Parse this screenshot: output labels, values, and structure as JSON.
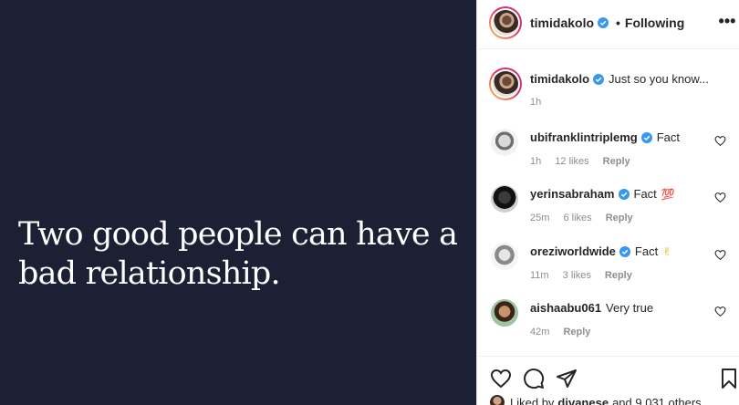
{
  "post": {
    "quote": "Two good people can have a bad relationship."
  },
  "header": {
    "username": "timidakolo",
    "separator": "•",
    "follow_state": "Following",
    "more_label": "•••"
  },
  "caption": {
    "username": "timidakolo",
    "text": "Just so you know...",
    "time": "1h"
  },
  "comments": [
    {
      "username": "ubifranklintriplemg",
      "text": "Fact",
      "emoji": "",
      "time": "1h",
      "likes": "12 likes",
      "reply": "Reply",
      "verified": true
    },
    {
      "username": "yerinsabraham",
      "text": "Fact",
      "emoji": "💯",
      "time": "25m",
      "likes": "6 likes",
      "reply": "Reply",
      "verified": true
    },
    {
      "username": "oreziworldwide",
      "text": "Fact",
      "emoji": "✌",
      "time": "11m",
      "likes": "3 likes",
      "reply": "Reply",
      "verified": true
    },
    {
      "username": "aishaabu061",
      "text": "Very true",
      "emoji": "",
      "time": "42m",
      "likes": "",
      "reply": "Reply",
      "verified": false
    }
  ],
  "footer": {
    "liked_prefix": "Liked by",
    "liked_user": "divanese",
    "liked_suffix": "and 9,031 others"
  },
  "colors": {
    "post_background": "#1b2034",
    "verified_blue": "#3897f0",
    "muted_text": "#8e8e8e"
  },
  "icons": [
    "verified-badge-icon",
    "more-options-icon",
    "heart-icon",
    "comment-icon",
    "share-icon",
    "bookmark-icon"
  ]
}
